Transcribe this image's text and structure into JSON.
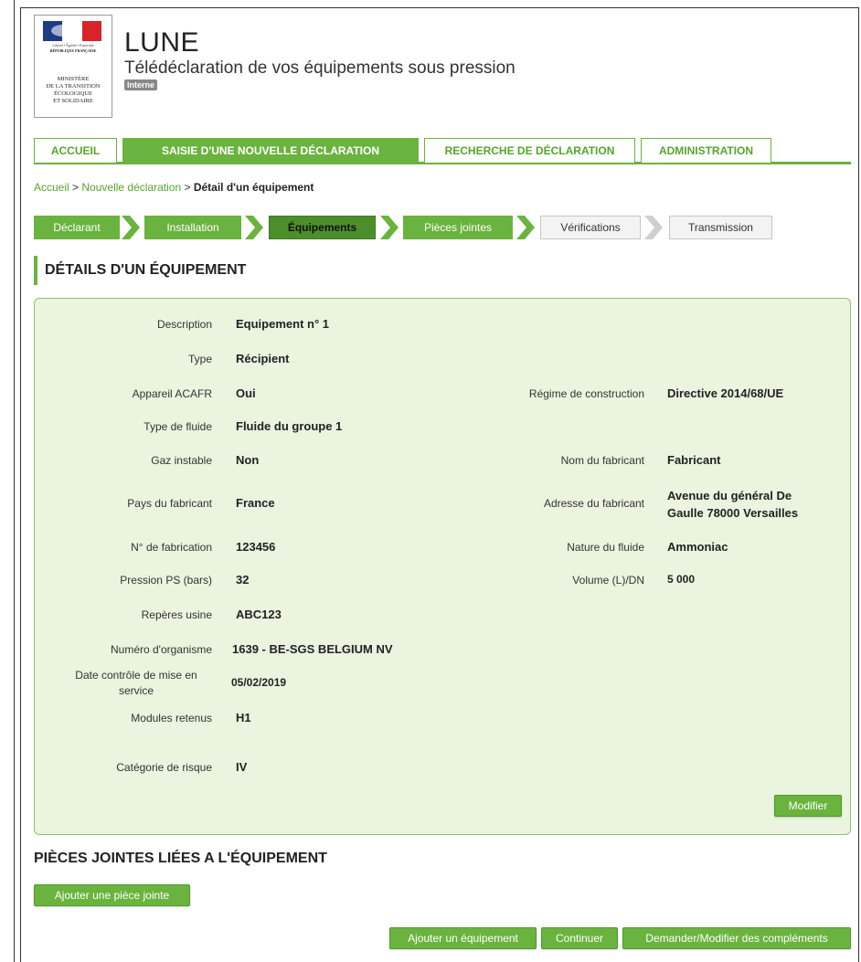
{
  "header": {
    "logo": {
      "motto": "Liberté • Égalité • Fraternité",
      "republic": "RÉPUBLIQUE FRANÇAISE",
      "ministry_lines": [
        "MINISTÈRE",
        "DE LA TRANSITION",
        "ÉCOLOGIQUE",
        "ET SOLIDAIRE"
      ]
    },
    "title": "LUNE",
    "subtitle": "Télédéclaration de vos équipements sous pression",
    "badge": "Interne"
  },
  "main_nav": {
    "tabs": [
      {
        "label": "ACCUEIL",
        "active": false
      },
      {
        "label": "SAISIE D'UNE NOUVELLE DÉCLARATION",
        "active": true
      },
      {
        "label": "RECHERCHE DE DÉCLARATION",
        "active": false
      },
      {
        "label": "ADMINISTRATION",
        "active": false
      }
    ]
  },
  "breadcrumb": {
    "items": [
      "Accueil",
      "Nouvelle déclaration",
      "Détail d'un équipement"
    ],
    "separator": ">"
  },
  "stepper": {
    "steps": [
      {
        "label": "Déclarant",
        "state": "done"
      },
      {
        "label": "Installation",
        "state": "done"
      },
      {
        "label": "Équipements",
        "state": "current"
      },
      {
        "label": "Pièces jointes",
        "state": "done"
      },
      {
        "label": "Vérifications",
        "state": "todo"
      },
      {
        "label": "Transmission",
        "state": "todo"
      }
    ]
  },
  "details": {
    "title": "DÉTAILS D'UN ÉQUIPEMENT",
    "left": [
      {
        "label": "Description",
        "value": "Equipement n° 1"
      },
      {
        "label": "Type",
        "value": "Récipient"
      },
      {
        "label": "Appareil ACAFR",
        "value": "Oui"
      },
      {
        "label": "Type de fluide",
        "value": "Fluide du groupe 1"
      },
      {
        "label": "Gaz instable",
        "value": "Non"
      },
      {
        "label": "Pays du fabricant",
        "value": "France"
      },
      {
        "label": "N° de fabrication",
        "value": "123456"
      },
      {
        "label": "Pression PS (bars)",
        "value": "32"
      },
      {
        "label": "Repères usine",
        "value": "ABC123"
      },
      {
        "label": "Numéro d'organisme",
        "value": "1639 - BE-SGS BELGIUM NV"
      },
      {
        "label_lines": [
          "Date contrôle de mise en",
          "service"
        ],
        "value": "05/02/2019"
      },
      {
        "label": "Modules retenus",
        "value": "H1"
      },
      {
        "label": "Catégorie de risque",
        "value": "IV"
      }
    ],
    "right": [
      {
        "label": "Régime de construction",
        "value": "Directive 2014/68/UE"
      },
      {
        "label": "Nom du fabricant",
        "value": "Fabricant"
      },
      {
        "label": "Adresse du fabricant",
        "value_lines": [
          "Avenue du général De",
          "Gaulle 78000 Versailles"
        ]
      },
      {
        "label": "Nature du fluide",
        "value": "Ammoniac"
      },
      {
        "label": "Volume (L)/DN",
        "value": "5 000"
      }
    ],
    "modify_button": "Modifier"
  },
  "attachments": {
    "title": "PIÈCES JOINTES LIÉES A L'ÉQUIPEMENT",
    "add_button": "Ajouter une pièce jointe"
  },
  "footer_buttons": {
    "add_equipment": "Ajouter un équipement",
    "continue": "Continuer",
    "request_complements": "Demander/Modifier des compléments"
  },
  "colors": {
    "accent": "#6ab33e",
    "accent_dark": "#4c8f2a",
    "panel_bg": "#eaf4df"
  }
}
